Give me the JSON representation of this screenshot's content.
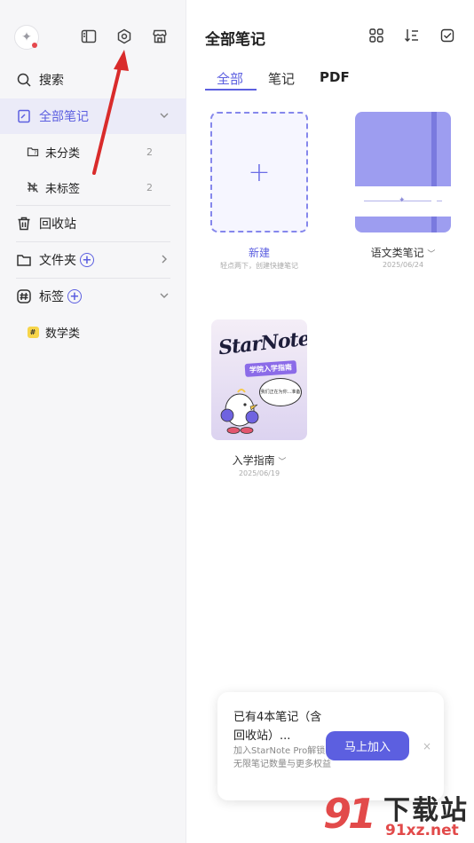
{
  "colors": {
    "accent": "#5c5fe0",
    "sidebar_bg": "#f6f6f8",
    "arrow": "#d92b2b"
  },
  "sidebar": {
    "avatar_icon": "sparkle-icon",
    "top_icons": [
      "panel-toggle-icon",
      "settings-hexagon-icon",
      "store-icon"
    ],
    "search": {
      "label": "搜索",
      "icon": "search-icon"
    },
    "all_notes": {
      "label": "全部笔记",
      "icon": "notebook-icon"
    },
    "uncategorized": {
      "label": "未分类",
      "count": "2",
      "icon": "folder-question-icon"
    },
    "untagged": {
      "label": "未标签",
      "count": "2",
      "icon": "tag-off-icon"
    },
    "trash": {
      "label": "回收站",
      "icon": "trash-icon"
    },
    "folders": {
      "label": "文件夹",
      "icon": "folder-icon"
    },
    "tags": {
      "label": "标签",
      "icon": "hash-icon"
    },
    "tag_items": [
      {
        "label": "数学类",
        "chip": "#"
      }
    ]
  },
  "main": {
    "title": "全部笔记",
    "header_icons": [
      "grid-view-icon",
      "sort-icon",
      "select-check-icon"
    ],
    "tabs": [
      {
        "label": "全部"
      },
      {
        "label": "笔记"
      },
      {
        "label": "PDF"
      }
    ],
    "new_card": {
      "plus": "+",
      "label": "新建",
      "hint": "轻点两下，创建快捷笔记"
    },
    "notebooks": [
      {
        "name": "语文类笔记",
        "date": "2025/06/24"
      },
      {
        "name": "入学指南",
        "date": "2025/06/19",
        "cover_logo": "StarNote",
        "cover_banner": "学院入学指南",
        "cover_bubble": "我们正在为你...准备"
      }
    ]
  },
  "promo": {
    "title": "已有4本笔记（含回收站）...",
    "description": "加入StarNote Pro解锁无限笔记数量与更多权益",
    "button": "马上加入",
    "close": "×"
  },
  "watermark": {
    "mark": "91",
    "title": "下载站",
    "url": "91xz.net"
  }
}
